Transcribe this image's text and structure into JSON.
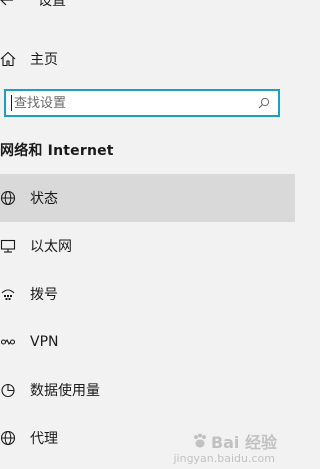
{
  "header": {
    "title": "设置",
    "back_icon": "back-arrow-icon"
  },
  "home": {
    "label": "主页",
    "icon": "home-icon"
  },
  "search": {
    "placeholder": "查找设置",
    "icon": "search-icon"
  },
  "section": {
    "heading": "网络和 Internet"
  },
  "nav": {
    "items": [
      {
        "label": "状态",
        "icon": "globe-status-icon",
        "selected": true
      },
      {
        "label": "以太网",
        "icon": "ethernet-icon",
        "selected": false
      },
      {
        "label": "拨号",
        "icon": "dialup-icon",
        "selected": false
      },
      {
        "label": "VPN",
        "icon": "vpn-icon",
        "selected": false
      },
      {
        "label": "数据使用量",
        "icon": "data-usage-icon",
        "selected": false
      },
      {
        "label": "代理",
        "icon": "proxy-globe-icon",
        "selected": false
      }
    ]
  },
  "watermark": {
    "text": "Bai 经验",
    "sub": "jingyan.baidu.com"
  },
  "colors": {
    "accent": "#1aa0c8",
    "background": "#f2f2f2",
    "selected": "#d9d9d9"
  }
}
